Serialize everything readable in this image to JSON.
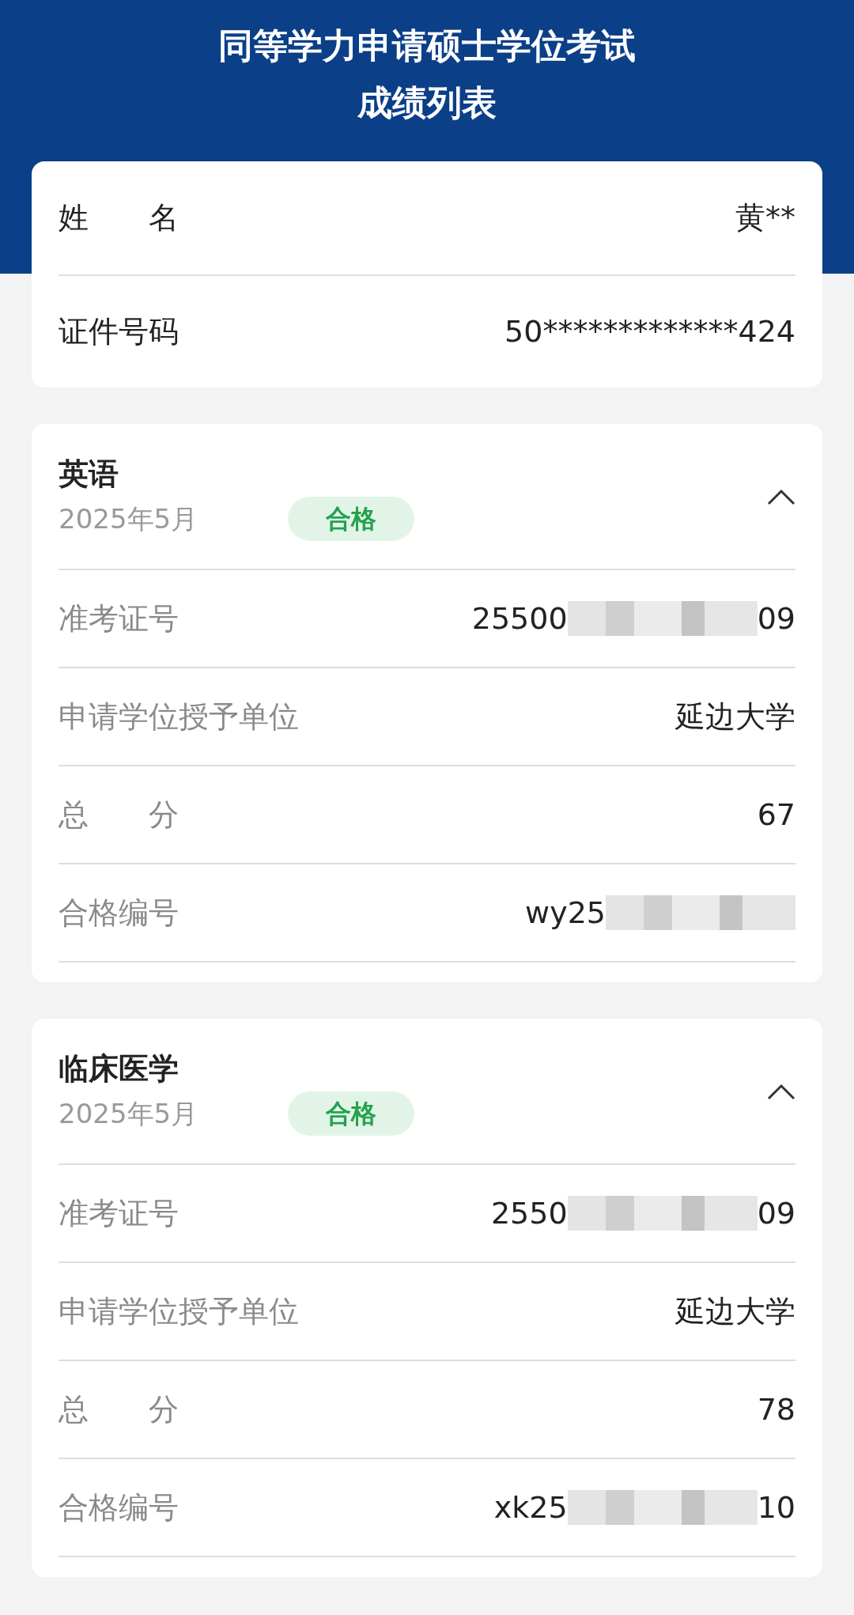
{
  "header": {
    "title_lines": [
      "同等学力申请硕士学位考试",
      "成绩列表"
    ]
  },
  "person": [
    {
      "label": "姓　　名",
      "value": "黄**"
    },
    {
      "label": "证件号码",
      "value": "50*************424"
    }
  ],
  "subjects": [
    {
      "name": "英语",
      "date": "2025年5月",
      "status": "合格",
      "expanded": true,
      "rows": [
        {
          "label": "准考证号",
          "value_start": "25500",
          "masked": true,
          "value_end": "09"
        },
        {
          "label": "申请学位授予单位",
          "value_start": "延边大学",
          "masked": false,
          "value_end": ""
        },
        {
          "label": "总　　分",
          "value_start": "67",
          "masked": false,
          "value_end": ""
        },
        {
          "label": "合格编号",
          "value_start": "wy25",
          "masked": true,
          "value_end": ""
        }
      ]
    },
    {
      "name": "临床医学",
      "date": "2025年5月",
      "status": "合格",
      "expanded": true,
      "rows": [
        {
          "label": "准考证号",
          "value_start": "2550",
          "masked": true,
          "value_end": "09"
        },
        {
          "label": "申请学位授予单位",
          "value_start": "延边大学",
          "masked": false,
          "value_end": ""
        },
        {
          "label": "总　　分",
          "value_start": "78",
          "masked": false,
          "value_end": ""
        },
        {
          "label": "合格编号",
          "value_start": "xk25",
          "masked": true,
          "value_end": "10"
        }
      ]
    }
  ]
}
